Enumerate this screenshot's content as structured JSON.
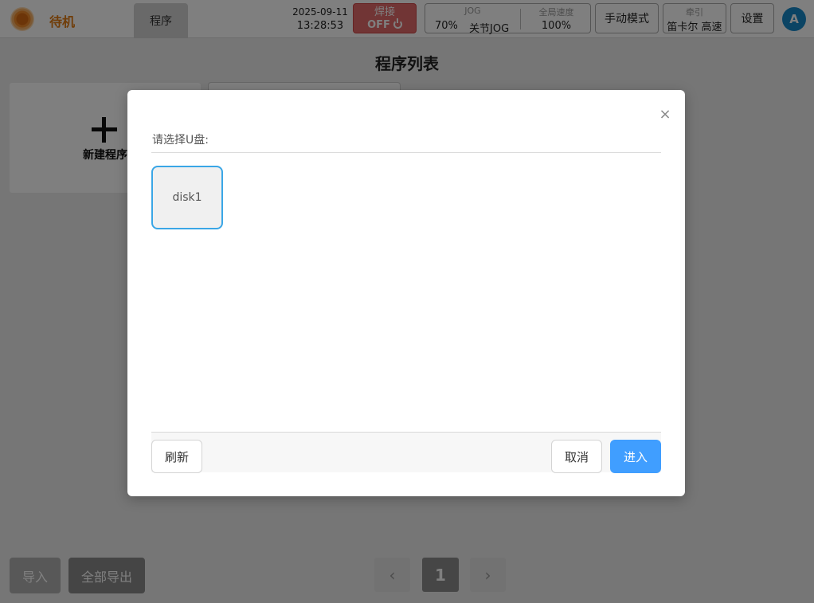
{
  "header": {
    "status": "待机",
    "tab_program": "程序",
    "date": "2025-09-11",
    "time": "13:28:53",
    "weld": {
      "label": "焊接",
      "state": "OFF"
    },
    "jog": {
      "title": "JOG",
      "percent": "70%",
      "mode": "关节JOG"
    },
    "global_speed": {
      "title": "全局速度",
      "value": "100%"
    },
    "manual_mode": "手动模式",
    "traction": {
      "title": "牵引",
      "value": "笛卡尔 高速"
    },
    "settings": "设置",
    "avatar": "A"
  },
  "main": {
    "title": "程序列表",
    "new_program": "新建程序",
    "import": "导入",
    "export_all": "全部导出",
    "pager": {
      "current": "1",
      "prev": "‹",
      "next": "›"
    }
  },
  "dialog": {
    "label": "请选择U盘:",
    "disks": [
      "disk1"
    ],
    "close": "×",
    "refresh": "刷新",
    "cancel": "取消",
    "enter": "进入"
  },
  "colors": {
    "accent": "#409eff",
    "disk_border": "#3aa6e6",
    "status_orange": "#e07b12",
    "weld_red": "#e26b6b",
    "avatar_blue": "#1688c9"
  }
}
